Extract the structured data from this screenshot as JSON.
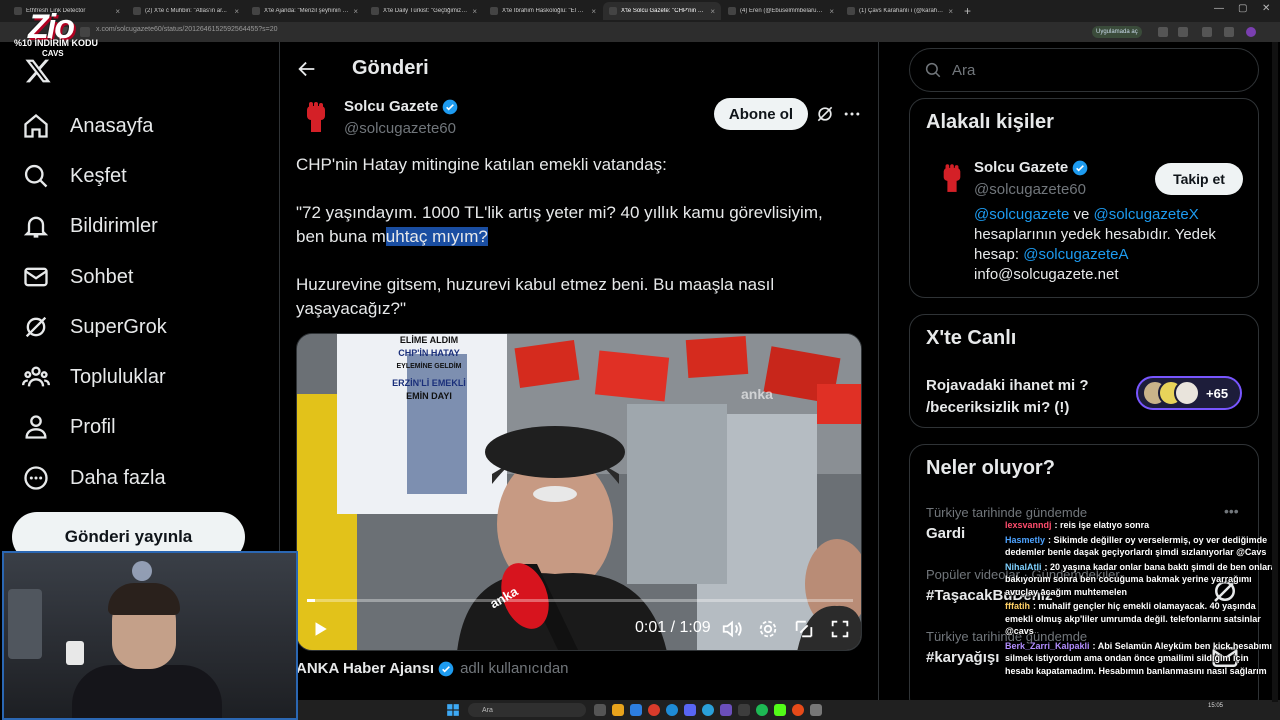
{
  "browser": {
    "tabs": [
      {
        "label": "Ethfresh Link Detector",
        "active": false
      },
      {
        "label": "(2) X'te ć Muhbiri: \"Atlas'ın ar...",
        "active": false
      },
      {
        "label": "X'te Ajanda: \"Menzil şeyhinin b...",
        "active": false
      },
      {
        "label": "X'te Daily Türkist: \"Geçtiğimiz y...",
        "active": false
      },
      {
        "label": "X'te İbrahim Haskoloğlu: \"El Sa...",
        "active": false
      },
      {
        "label": "X'te Solcu Gazete: \"CHP'nin Ha...",
        "active": true
      },
      {
        "label": "(4) Eren (@Ebuselmmbelarus) /...",
        "active": false
      },
      {
        "label": "(1) Çavs Karahanlı ı (@karahan...",
        "active": false
      }
    ],
    "url": "x.com/solcugazete60/status/2012646152592564455?s=20",
    "app_button": "Uygulamada aç"
  },
  "overlay": {
    "brand": "Zio",
    "promo": "%10 İNDİRİM KODU",
    "code": "CAVS"
  },
  "nav": {
    "items": [
      {
        "label": "Anasayfa",
        "icon": "home-icon"
      },
      {
        "label": "Keşfet",
        "icon": "search-icon"
      },
      {
        "label": "Bildirimler",
        "icon": "bell-icon"
      },
      {
        "label": "Sohbet",
        "icon": "mail-icon"
      },
      {
        "label": "SuperGrok",
        "icon": "grok-icon"
      },
      {
        "label": "Topluluklar",
        "icon": "people-icon"
      },
      {
        "label": "Profil",
        "icon": "person-icon"
      },
      {
        "label": "Daha fazla",
        "icon": "more-circle-icon"
      }
    ],
    "post_button": "Gönderi yayınla"
  },
  "post": {
    "header_title": "Gönderi",
    "author_name": "Solcu Gazete",
    "author_handle": "@solcugazete60",
    "subscribe_label": "Abone ol",
    "text_1": "CHP'nin Hatay mitingine katılan emekli vatandaş:",
    "text_2a": "\"72 yaşındayım. 1000 TL'lik artış yeter mi? 40 yıllık kamu görevlisiyim,",
    "text_2b_plain": "ben buna m",
    "text_2b_highlight": "uhtaç mıyım?",
    "text_3": "Huzurevine gitsem, huzurevi kabul etmez beni. Bu maaşla nasıl yaşayacağız?\"",
    "video": {
      "time": "0:01 / 1:09",
      "progress": 0.014,
      "sign_line1": "ELİME ALDIM",
      "sign_line2": "CHP'İN HATAY",
      "sign_line3": "EYLEMİNE GELDİM",
      "sign_line4": "ERZİN'Lİ EMEKLİ",
      "sign_line5": "EMİN DAYI",
      "watermark": "anka",
      "mic_label": "anka"
    },
    "source_name": "ANKA Haber Ajansı",
    "source_sub": "adlı kullanıcıdan"
  },
  "right": {
    "search_placeholder": "Ara",
    "related": {
      "title": "Alakalı kişiler",
      "name": "Solcu Gazete",
      "handle": "@solcugazete60",
      "follow_label": "Takip et",
      "bio_link1": "@solcugazete",
      "bio_and": " ve ",
      "bio_link2": "@solcugazeteX",
      "bio_mid": " hesaplarının yedek hesabıdır. Yedek hesap: ",
      "bio_link3": "@solcugazeteA",
      "bio_email": "info@solcugazete.net"
    },
    "live": {
      "title": "X'te Canlı",
      "text": "Rojavadaki ihanet mi ? /beceriksizlik mi?  (!)",
      "count": "+65"
    },
    "trends": {
      "title": "Neler oluyor?",
      "items": [
        {
          "meta": "Türkiye tarihinde gündemde",
          "name": "Gardi"
        },
        {
          "meta": "Popüler videolar · Gündemdekiler",
          "name": "#TaşacakBuDeniz"
        },
        {
          "meta": "Türkiye tarihinde gündemde",
          "name": "#karyağışı"
        }
      ]
    }
  },
  "chat": [
    {
      "user": "lexsvanndj",
      "color": "#ff4d6d",
      "msg": ": reis işe elatıyo sonra"
    },
    {
      "user": "Hasmetly",
      "color": "#4da3ff",
      "msg": ": Sikimde değiller oy verselermiş, oy ver dediğimde dedemler benle daşak geçiyorlardı şimdi sızlanıyorlar @Cavs"
    },
    {
      "user": "NihalAtli",
      "color": "#7fd1ff",
      "msg": ": 20 yaşına kadar onlar bana baktı şimdi de ben onlara bakıyorum sonra ben cocuğuma bakmak yerine yarrağımı avuçlay acağım muhtemelen"
    },
    {
      "user": "fffatih",
      "color": "#ffd166",
      "msg": ": muhalif gençler hiç emekli olamayacak. 40 yaşında emekli olmuş akp'liler umrumda değil. telefonlarını satsinlar @cavs"
    },
    {
      "user": "Berk_Zarri_Kalpakli",
      "color": "#b28dff",
      "msg": ": Abi Selamün Aleyküm ben kick hesabımı silmek istiyordum ama ondan önce gmailimi sildiğim için hesabı kapatamadım. Hesabımın banlanmasını nasıl sağlarım"
    }
  ],
  "taskbar": {
    "search": "Ara",
    "clock": "15:05"
  },
  "colors": {
    "accent": "#1d9bf0",
    "background": "#000000",
    "border": "#2f3336",
    "secondary_text": "#71767b",
    "live_border": "#7856ff"
  }
}
